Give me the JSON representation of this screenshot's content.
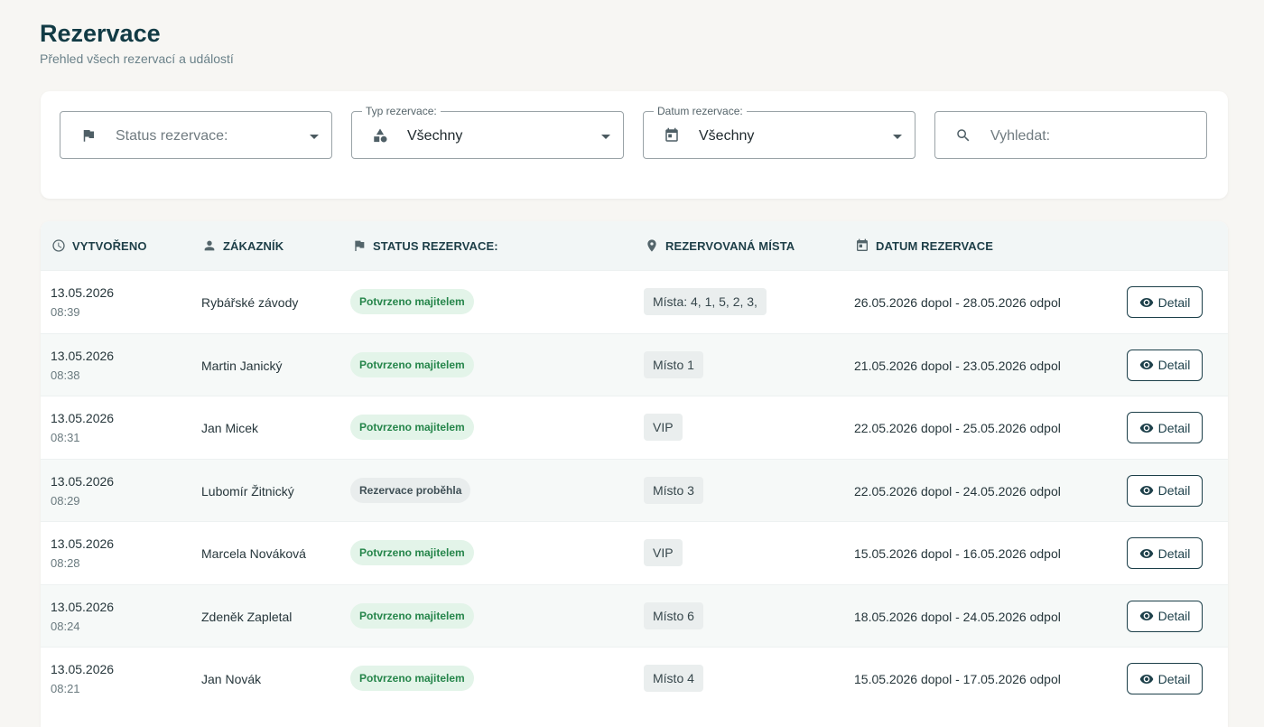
{
  "page": {
    "title": "Rezervace",
    "subtitle": "Přehled všech rezervací a událostí"
  },
  "filters": {
    "status": {
      "placeholder": "Status rezervace:",
      "icon": "flag-icon"
    },
    "type": {
      "legend": "Typ rezervace:",
      "value": "Všechny",
      "icon": "shapes-icon"
    },
    "date": {
      "legend": "Datum rezervace:",
      "value": "Všechny",
      "icon": "calendar-icon"
    },
    "search": {
      "placeholder": "Vyhledat:",
      "icon": "search-icon"
    }
  },
  "table": {
    "headers": {
      "created": "VYTVOŘENO",
      "customer": "ZÁKAZNÍK",
      "status": "STATUS REZERVACE:",
      "places": "REZERVOVANÁ MÍSTA",
      "date": "DATUM REZERVACE"
    },
    "detail_label": "Detail",
    "rows": [
      {
        "date": "13.05.2026",
        "time": "08:39",
        "customer": "Rybářské závody",
        "status": "Potvrzeno majitelem",
        "status_type": "ok",
        "places": "Místa: 4, 1, 5, 2, 3,",
        "range": "26.05.2026 dopol - 28.05.2026 odpol"
      },
      {
        "date": "13.05.2026",
        "time": "08:38",
        "customer": "Martin Janický",
        "status": "Potvrzeno majitelem",
        "status_type": "ok",
        "places": "Místo 1",
        "range": "21.05.2026 dopol - 23.05.2026 odpol"
      },
      {
        "date": "13.05.2026",
        "time": "08:31",
        "customer": "Jan Micek",
        "status": "Potvrzeno majitelem",
        "status_type": "ok",
        "places": "VIP",
        "range": "22.05.2026 dopol - 25.05.2026 odpol"
      },
      {
        "date": "13.05.2026",
        "time": "08:29",
        "customer": "Lubomír Žitnický",
        "status": "Rezervace proběhla",
        "status_type": "done",
        "places": "Místo 3",
        "range": "22.05.2026 dopol - 24.05.2026 odpol"
      },
      {
        "date": "13.05.2026",
        "time": "08:28",
        "customer": "Marcela Nováková",
        "status": "Potvrzeno majitelem",
        "status_type": "ok",
        "places": "VIP",
        "range": "15.05.2026 dopol - 16.05.2026 odpol"
      },
      {
        "date": "13.05.2026",
        "time": "08:24",
        "customer": "Zdeněk Zapletal",
        "status": "Potvrzeno majitelem",
        "status_type": "ok",
        "places": "Místo 6",
        "range": "18.05.2026 dopol - 24.05.2026 odpol"
      },
      {
        "date": "13.05.2026",
        "time": "08:21",
        "customer": "Jan Novák",
        "status": "Potvrzeno majitelem",
        "status_type": "ok",
        "places": "Místo 4",
        "range": "15.05.2026 dopol - 17.05.2026 odpol"
      }
    ]
  },
  "colors": {
    "background": "#f7f6f3",
    "primary": "#1c3f49",
    "badge_ok_bg": "#e3f4e9",
    "badge_ok_text": "#25854a",
    "badge_done_bg": "#e9eded"
  }
}
